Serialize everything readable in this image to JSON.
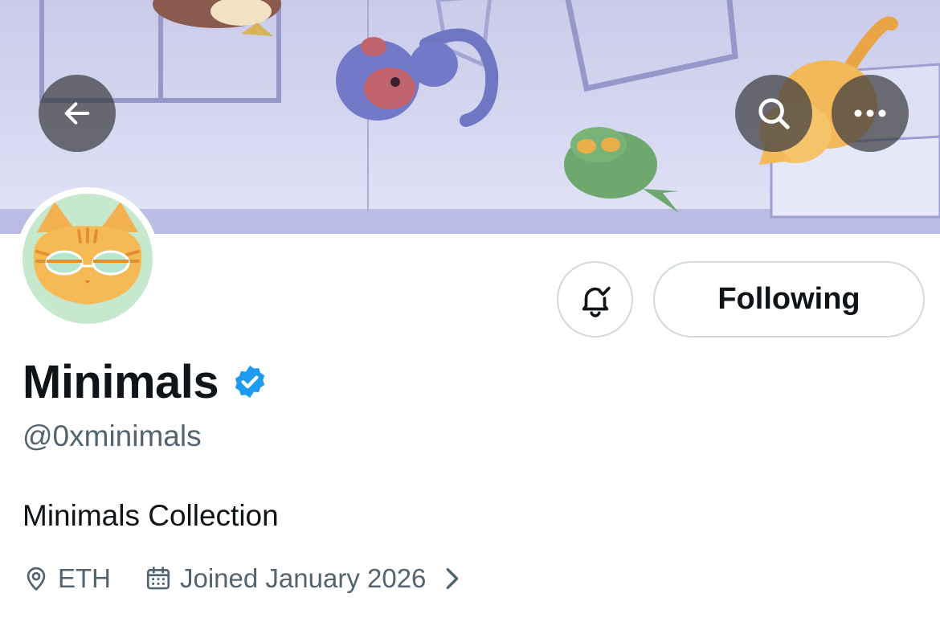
{
  "profile": {
    "display_name": "Minimals",
    "handle": "@0xminimals",
    "bio": "Minimals Collection",
    "location": "ETH",
    "joined": "Joined January 2026",
    "verified": true
  },
  "actions": {
    "following_label": "Following"
  },
  "icons": {
    "back": "arrow-left-icon",
    "search": "search-icon",
    "more": "more-horizontal-icon",
    "notifications": "bell-check-icon",
    "verified": "verified-badge-icon",
    "location": "location-pin-icon",
    "calendar": "calendar-icon",
    "chevron": "chevron-right-icon"
  },
  "colors": {
    "text_primary": "#0f1419",
    "text_secondary": "#536471",
    "verified_blue": "#1d9bf0",
    "button_border": "#cfd9de",
    "banner_bg": "#d6d8f1",
    "avatar_bg": "#c6e8cc",
    "overlay_button": "#3c3c40"
  }
}
